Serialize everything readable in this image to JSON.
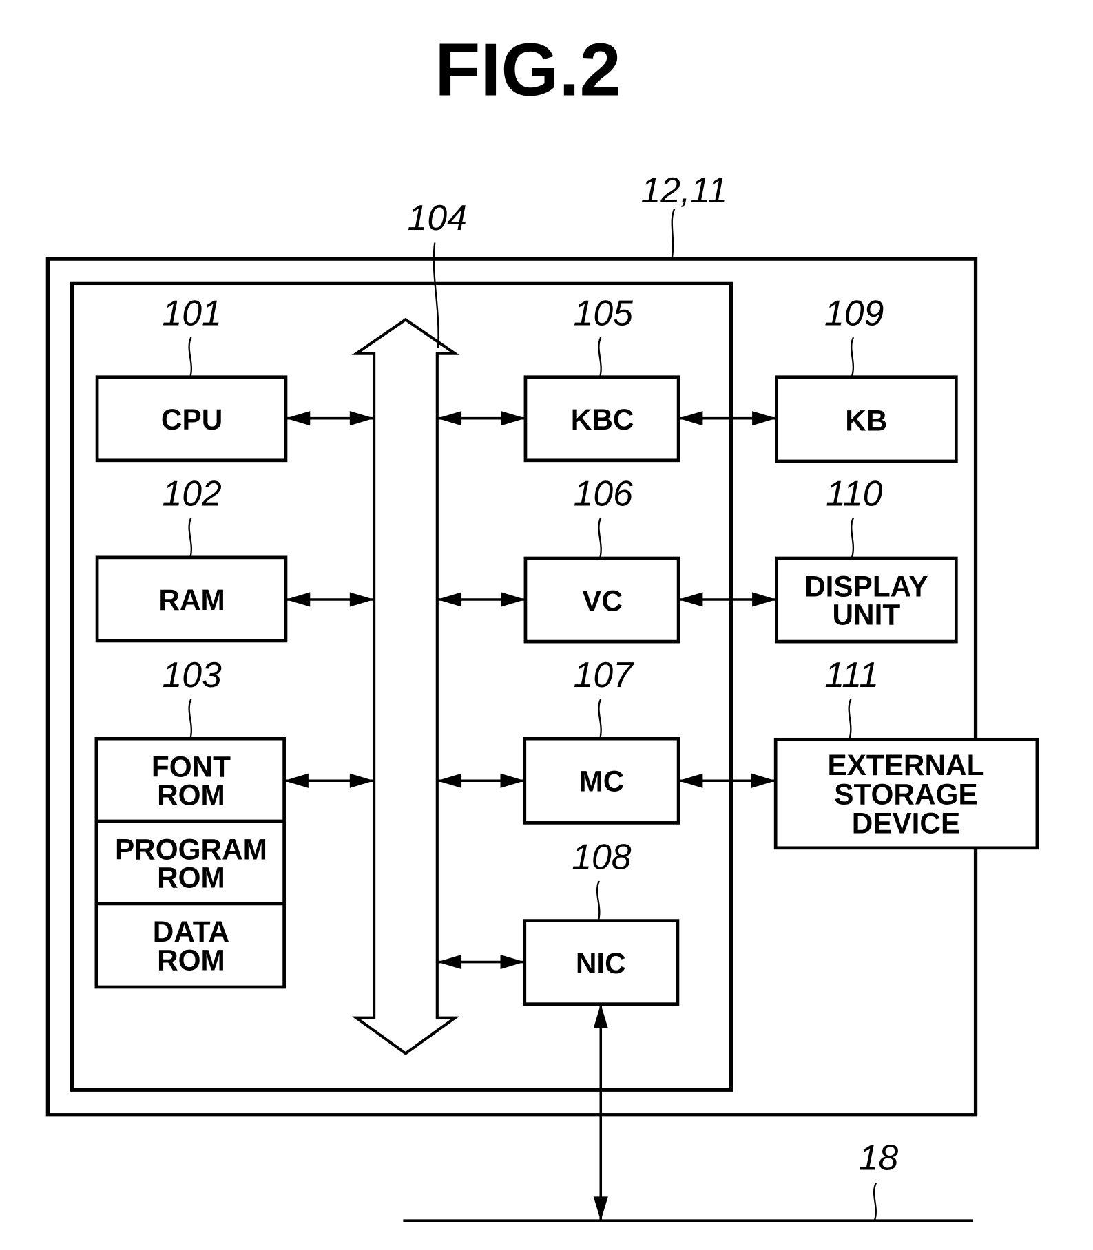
{
  "figure": {
    "title": "FIG.2",
    "system_ref": "12,11",
    "bus_ref": "104",
    "network_ref": "18"
  },
  "blocks": {
    "cpu": {
      "label": "CPU",
      "ref": "101"
    },
    "ram": {
      "label": "RAM",
      "ref": "102"
    },
    "rom": {
      "ref": "103",
      "sections": [
        {
          "lines": [
            "FONT",
            "ROM"
          ]
        },
        {
          "lines": [
            "PROGRAM",
            "ROM"
          ]
        },
        {
          "lines": [
            "DATA",
            "ROM"
          ]
        }
      ]
    },
    "kbc": {
      "label": "KBC",
      "ref": "105"
    },
    "vc": {
      "label": "VC",
      "ref": "106"
    },
    "mc": {
      "label": "MC",
      "ref": "107"
    },
    "nic": {
      "label": "NIC",
      "ref": "108"
    },
    "kb": {
      "label": "KB",
      "ref": "109"
    },
    "display": {
      "lines": [
        "DISPLAY",
        "UNIT"
      ],
      "ref": "110"
    },
    "storage": {
      "lines": [
        "EXTERNAL",
        "STORAGE",
        "DEVICE"
      ],
      "ref": "111"
    }
  },
  "connections": [
    {
      "from": "cpu",
      "to": "bus",
      "type": "bidirectional"
    },
    {
      "from": "ram",
      "to": "bus",
      "type": "bidirectional"
    },
    {
      "from": "rom",
      "to": "bus",
      "type": "bidirectional"
    },
    {
      "from": "bus",
      "to": "kbc",
      "type": "bidirectional"
    },
    {
      "from": "bus",
      "to": "vc",
      "type": "bidirectional"
    },
    {
      "from": "bus",
      "to": "mc",
      "type": "bidirectional"
    },
    {
      "from": "bus",
      "to": "nic",
      "type": "bidirectional"
    },
    {
      "from": "kbc",
      "to": "kb",
      "type": "bidirectional"
    },
    {
      "from": "vc",
      "to": "display",
      "type": "bidirectional"
    },
    {
      "from": "mc",
      "to": "storage",
      "type": "bidirectional"
    },
    {
      "from": "nic",
      "to": "network",
      "type": "bidirectional"
    }
  ]
}
